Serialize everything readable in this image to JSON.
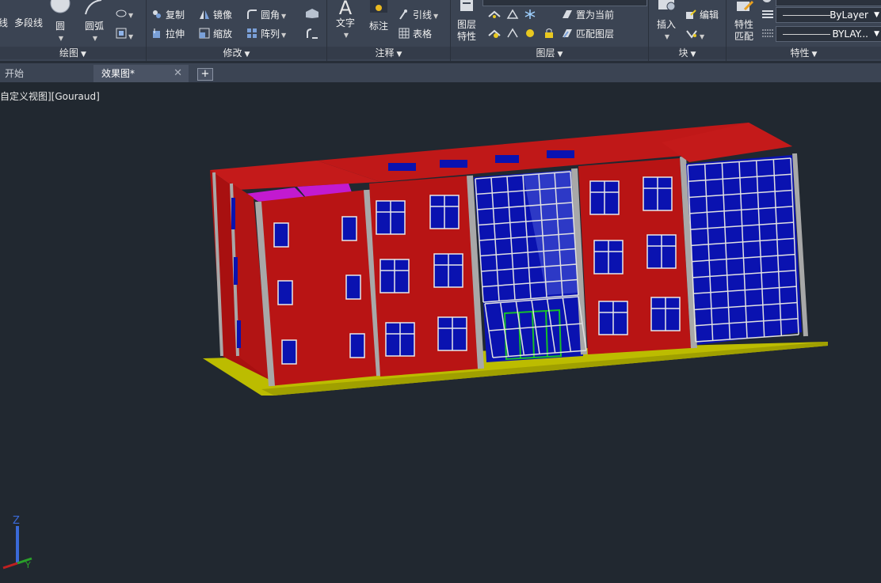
{
  "ribbon": {
    "draw_panel": {
      "title": "绘图",
      "line_label": "线",
      "polyline_label": "多段线",
      "circle_label": "圆",
      "arc_label": "圆弧"
    },
    "modify_panel": {
      "title": "修改",
      "copy_label": "复制",
      "mirror_label": "镜像",
      "fillet_label": "圆角",
      "stretch_label": "拉伸",
      "scale_label": "缩放",
      "array_label": "阵列"
    },
    "annotation_panel": {
      "title": "注释",
      "text_label": "文字",
      "dimension_label": "标注",
      "leader_label": "引线",
      "table_label": "表格"
    },
    "layers_panel": {
      "title": "图层",
      "layer_properties_label": "图层\n特性",
      "make_current_label": "置为当前",
      "match_layer_label": "匹配图层"
    },
    "block_panel": {
      "title": "块",
      "insert_label": "插入",
      "edit_label": "编辑"
    },
    "properties_panel": {
      "title": "特性",
      "match_properties_label": "特性\n匹配",
      "linetype_value": "ByLayer",
      "lineweight_value": "BYLAY..."
    }
  },
  "tabs": [
    {
      "label": "开始",
      "active": false
    },
    {
      "label": "效果图*",
      "active": true
    }
  ],
  "viewport": {
    "label": "自定义视图][Gouraud]",
    "ucs_z": "Z",
    "ucs_y": "Y"
  },
  "colors": {
    "ribbon_bg": "#3b4453",
    "canvas_bg": "#212830",
    "wall_red": "#b81414",
    "glass_blue": "#0a12b0",
    "base_yellow": "#bcbc00",
    "roof_magenta": "#c21ad0",
    "column_gray": "#a8a8a8",
    "door_green": "#18c028"
  }
}
